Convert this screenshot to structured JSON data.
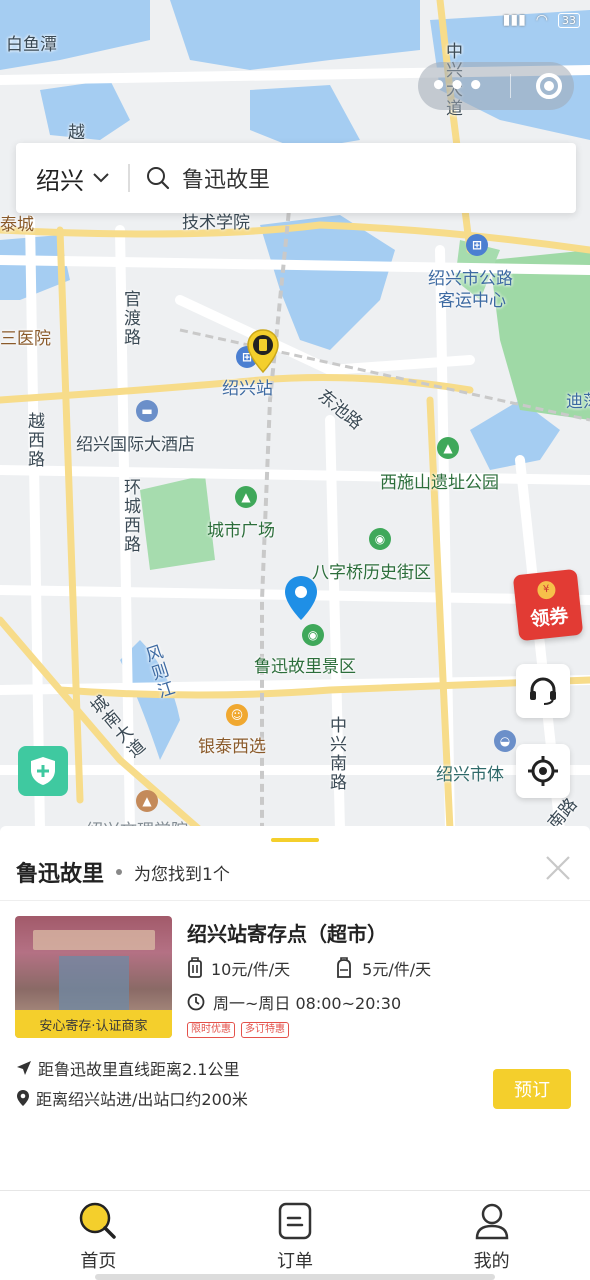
{
  "status_bar": {
    "time": "",
    "battery": "33"
  },
  "mini_program": {
    "more_icon": "more-dots-icon",
    "close_icon": "target-ring-icon"
  },
  "search": {
    "city": "绍兴",
    "query": "鲁迅故里"
  },
  "map": {
    "labels": {
      "bai_yu_tan": "白鱼潭",
      "zhong_xing_da_dao": "中兴大道",
      "yue": "越",
      "tai_cheng": "泰城",
      "ji_shu_xue_yuan": "技术学院",
      "gongLu_keyun_1": "绍兴市公路",
      "gongLu_keyun_2": "客运中心",
      "guan_du_lu": "官渡路",
      "san_yiyuan": "三医院",
      "shaoxing_zhan": "绍兴站",
      "dong_chi_lu": "东池路",
      "di": "迪荡",
      "yue_xi_lu": "越西路",
      "guoji_jiudian": "绍兴国际大酒店",
      "xishishan": "西施山遗址公园",
      "huan_cheng_xi_lu": "环城西路",
      "chengshi_guangchang": "城市广场",
      "bazi_qiao": "八字桥历史街区",
      "luxun_guli": "鲁迅故里景区",
      "feng_ze_jiang": "风则江",
      "cheng_nan_da_dao": "城南大道",
      "yintai": "银泰西选",
      "zhong_xing_nan_lu": "中兴南路",
      "shaoxing_shi_ti": "绍兴市体",
      "nan_lu": "南路",
      "bottom_cut": "绍兴文理学院"
    },
    "coupon_label": "领券",
    "pin_icon": "storage-pin-icon"
  },
  "results": {
    "keyword": "鲁迅故里",
    "count_text": "为您找到1个",
    "store": {
      "name": "绍兴站寄存点（超市）",
      "image_badge": "安心寄存·认证商家",
      "price_large": "10元/件/天",
      "price_small": "5元/件/天",
      "hours": "周一~周日 08:00~20:30",
      "tags": [
        "限时优惠",
        "多订特惠"
      ],
      "distance_line": "距鲁迅故里直线距离2.1公里",
      "station_line": "距离绍兴站进/出站口约200米",
      "book_label": "预订"
    }
  },
  "tabs": [
    {
      "label": "首页",
      "icon": "search-icon"
    },
    {
      "label": "订单",
      "icon": "order-icon"
    },
    {
      "label": "我的",
      "icon": "user-icon"
    }
  ]
}
